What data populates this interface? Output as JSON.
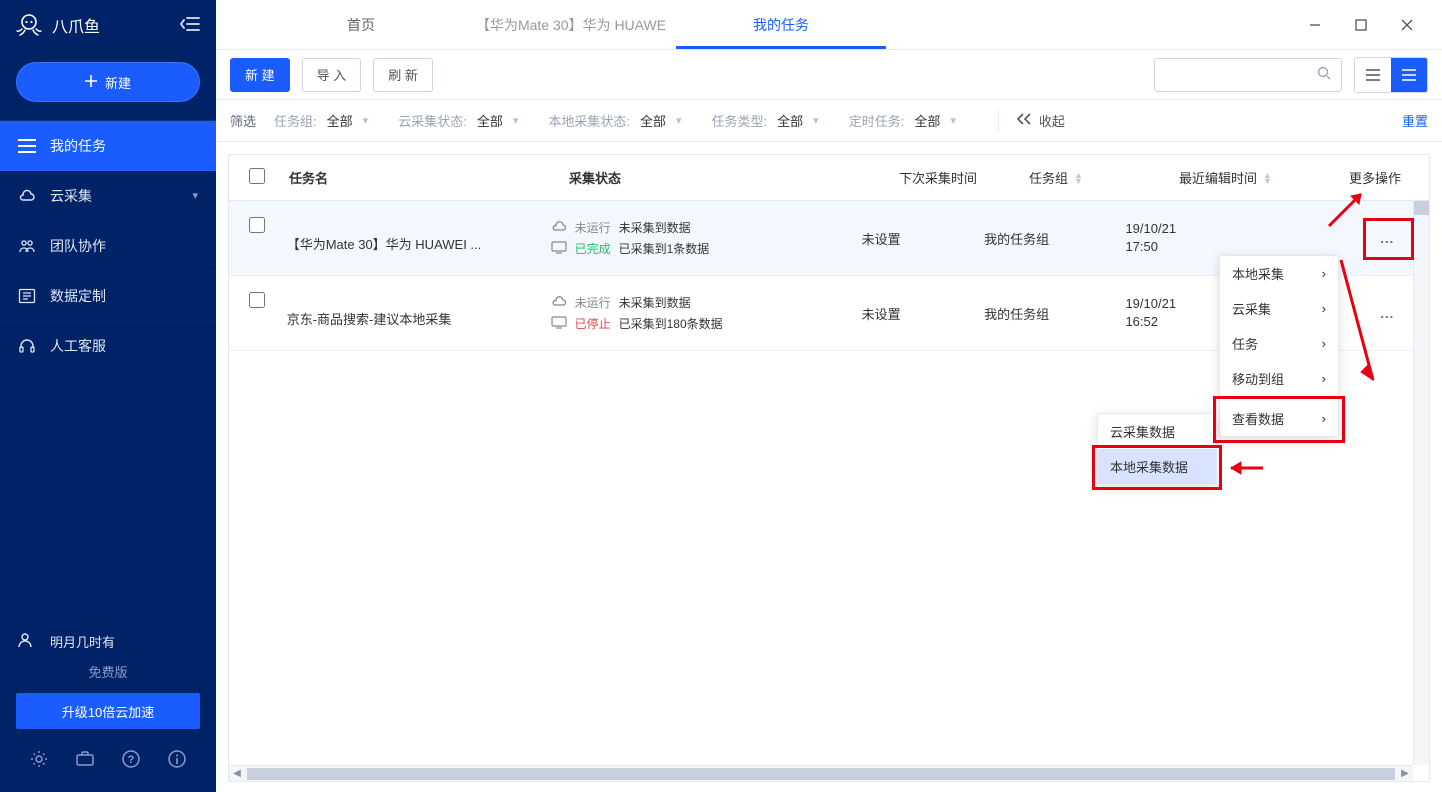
{
  "brand": "八爪鱼",
  "sidebar": {
    "new_label": "新建",
    "items": [
      {
        "label": "我的任务"
      },
      {
        "label": "云采集"
      },
      {
        "label": "团队协作"
      },
      {
        "label": "数据定制"
      },
      {
        "label": "人工客服"
      }
    ],
    "user": "明月几时有",
    "plan": "免费版",
    "upgrade": "升级10倍云加速"
  },
  "tabs": {
    "items": [
      {
        "label": "首页"
      },
      {
        "label": "【华为Mate 30】华为 HUAWE"
      },
      {
        "label": "我的任务"
      }
    ]
  },
  "toolbar": {
    "new": "新 建",
    "import": "导 入",
    "refresh": "刷 新"
  },
  "filters": {
    "label": "筛选",
    "items": [
      {
        "key": "任务组:",
        "val": "全部"
      },
      {
        "key": "云采集状态:",
        "val": "全部"
      },
      {
        "key": "本地采集状态:",
        "val": "全部"
      },
      {
        "key": "任务类型:",
        "val": "全部"
      },
      {
        "key": "定时任务:",
        "val": "全部"
      }
    ],
    "collapse": "收起",
    "reset": "重置"
  },
  "table": {
    "headers": {
      "name": "任务名",
      "status": "采集状态",
      "next": "下次采集时间",
      "group": "任务组",
      "time": "最近编辑时间",
      "more": "更多操作"
    },
    "rows": [
      {
        "name": "【华为Mate 30】华为 HUAWEI ...",
        "cloud_state": "未运行",
        "cloud_data": "未采集到数据",
        "local_state": "已完成",
        "local_state_class": "tag-green",
        "local_data": "已采集到1条数据",
        "next": "未设置",
        "group": "我的任务组",
        "time1": "19/10/21",
        "time2": "17:50",
        "more": "..."
      },
      {
        "name": "京东-商品搜索-建议本地采集",
        "cloud_state": "未运行",
        "cloud_data": "未采集到数据",
        "local_state": "已停止",
        "local_state_class": "tag-red",
        "local_data": "已采集到180条数据",
        "next": "未设置",
        "group": "我的任务组",
        "time1": "19/10/21",
        "time2": "16:52",
        "more": "..."
      }
    ]
  },
  "dropdown1": {
    "items": [
      {
        "label": "本地采集"
      },
      {
        "label": "云采集"
      },
      {
        "label": "任务"
      },
      {
        "label": "移动到组"
      },
      {
        "label": "查看数据"
      }
    ]
  },
  "dropdown2": {
    "items": [
      {
        "label": "云采集数据"
      },
      {
        "label": "本地采集数据"
      }
    ]
  }
}
